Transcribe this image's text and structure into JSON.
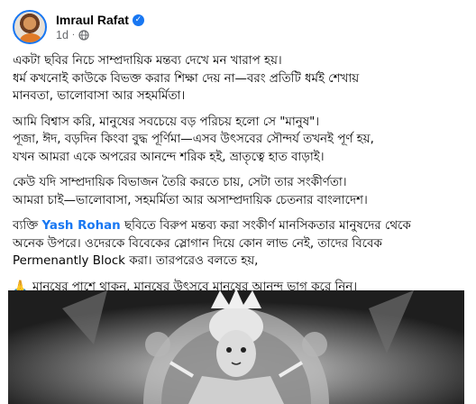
{
  "post": {
    "author": "Imraul Rafat",
    "verified_glyph": "✓",
    "time": "1d",
    "separator": "·",
    "privacy_icon": "globe-icon"
  },
  "paragraphs": [
    {
      "lines": [
        "একটা ছবির নিচে সাম্প্রদায়িক মন্তব্য দেখে মন খারাপ হয়।",
        "ধর্ম কখনোই কাউকে বিভক্ত করার শিক্ষা দেয় না—বরং প্রতিটি ধর্মই শেখায়",
        "মানবতা, ভালোবাসা আর সহমর্মিতা।"
      ]
    },
    {
      "lines": [
        "আমি বিশ্বাস করি, মানুষের সবচেয়ে বড় পরিচয় হলো সে \"মানুষ\"।",
        "পূজা, ঈদ, বড়দিন কিংবা বুদ্ধ পূর্ণিমা—এসব উৎসবের সৌন্দর্য তখনই পূর্ণ হয়,",
        "যখন আমরা একে অপরের আনন্দে শরিক হই, ভ্রাতৃত্বে হাত বাড়াই।"
      ]
    },
    {
      "lines": [
        "কেউ যদি সাম্প্রদায়িক বিভাজন তৈরি করতে চায়, সেটা তার সংকীর্ণতা।",
        "আমরা চাই—ভালোবাসা, সহমর্মিতা আর অসাম্প্রদায়িক চেতনার বাংলাদেশ।"
      ]
    }
  ],
  "mention_paragraph": {
    "prefix": "ব্যক্তি ",
    "mention": "Yash Rohan",
    "line1_suffix": " ছবিতে বিরুপ মন্তব্য করা সংকীর্ণ মানসিকতার মানুষদের থেকে",
    "line2": "অনেক উপরে। ওদেরকে বিবেকের স্লোগান দিয়ে কোন লাভ নেই, তাদের বিবেক",
    "line3": "Permenantly Block করা। তারপরেও বলতে হয়,"
  },
  "closing": {
    "emoji": "🙏",
    "text": "মানুষের পাশে থাকুন, মানুষের উৎসবে মানুষের আনন্দ ভাগ করে নিন।"
  },
  "photo": {
    "description_icon": "goddess-idol-photo"
  },
  "colors": {
    "link": "#1877f2",
    "secondary_text": "#65676b",
    "text": "#050505"
  }
}
